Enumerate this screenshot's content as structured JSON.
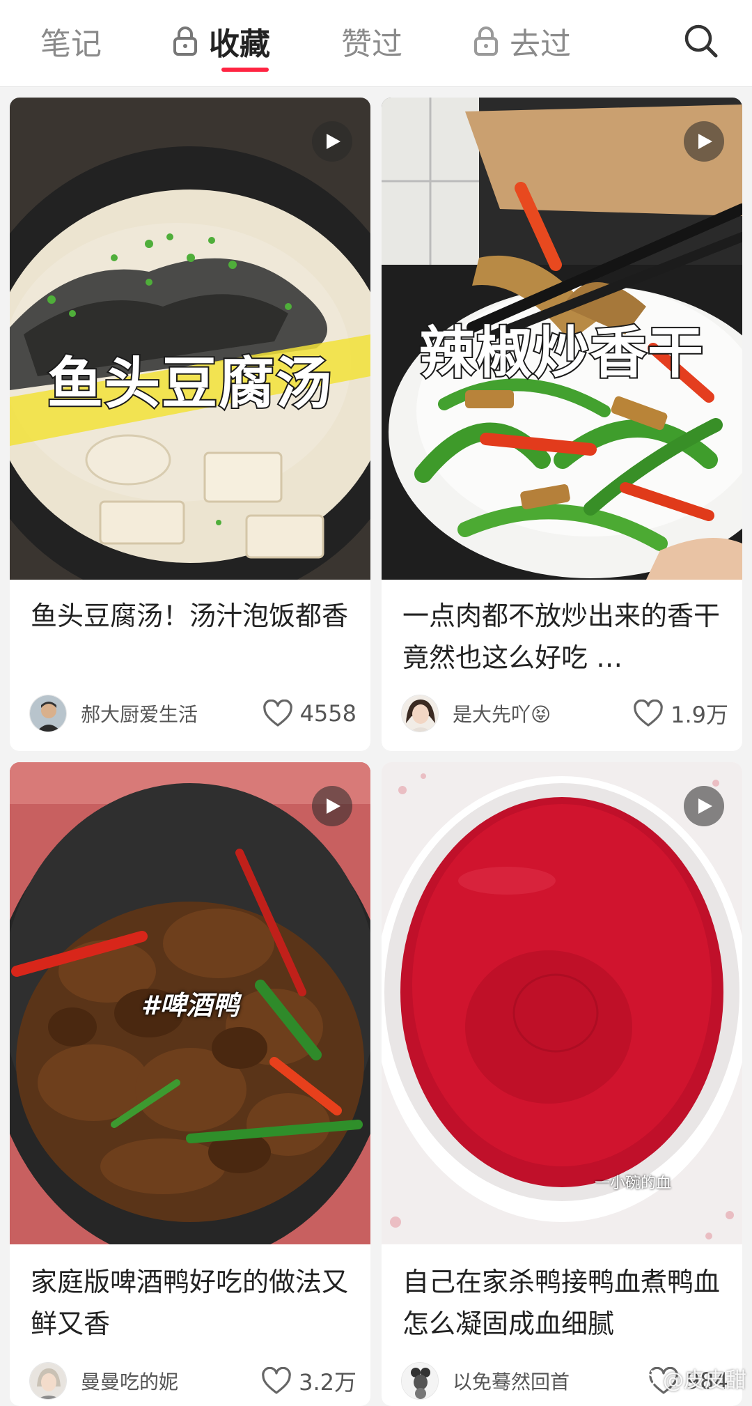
{
  "tabs": [
    {
      "label": "笔记",
      "locked": false,
      "active": false
    },
    {
      "label": "收藏",
      "locked": true,
      "active": true
    },
    {
      "label": "赞过",
      "locked": false,
      "active": false
    },
    {
      "label": "去过",
      "locked": true,
      "active": false
    }
  ],
  "accent_color": "#ff2442",
  "search_icon": "search-icon",
  "cards": [
    {
      "cover_text": "鱼头豆腐汤",
      "title": "鱼头豆腐汤！汤汁泡饭都香",
      "author": "郝大厨爱生活",
      "likes": "4558",
      "is_video": true
    },
    {
      "cover_text": "辣椒炒香干",
      "title": "一点肉都不放炒出来的香干竟然也这么好吃 …",
      "author": "是大先吖😝",
      "likes": "1.9万",
      "is_video": true
    },
    {
      "cover_text": "#啤酒鸭",
      "title": "家庭版啤酒鸭好吃的做法又鲜又香",
      "author": "曼曼吃的妮",
      "likes": "3.2万",
      "is_video": true
    },
    {
      "cover_text": "一小碗的血",
      "title": "自己在家杀鸭接鸭血煮鸭血怎么凝固成血细腻",
      "author": "以免蓦然回首",
      "likes": "984",
      "is_video": true
    }
  ],
  "watermark": "@皮皮甜"
}
